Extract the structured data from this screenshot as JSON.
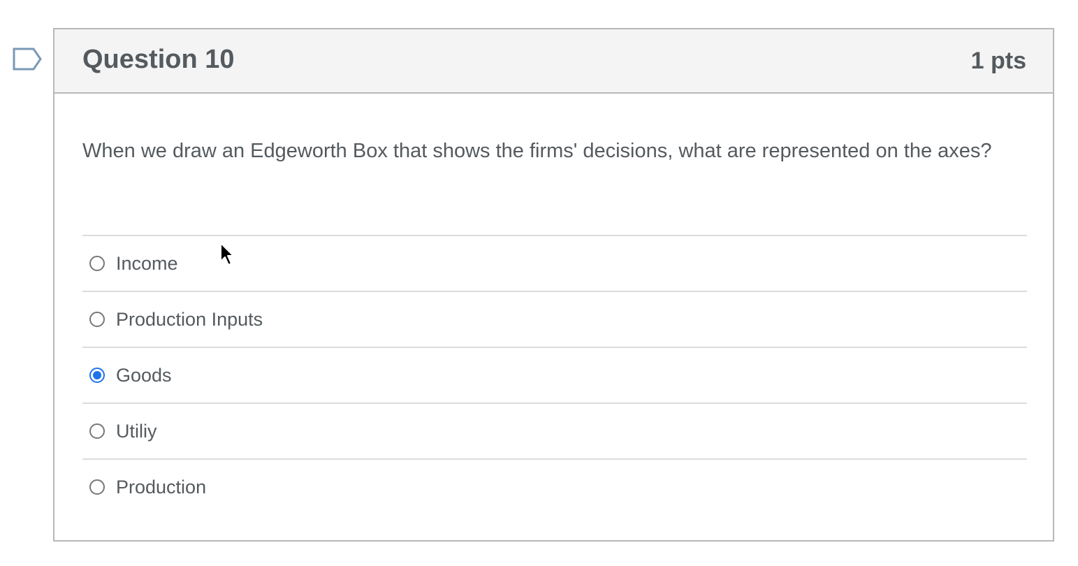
{
  "question": {
    "title": "Question 10",
    "points": "1 pts",
    "text": "When we draw an Edgeworth Box that shows the firms' decisions, what are represented on the axes?"
  },
  "answers": [
    {
      "label": "Income",
      "selected": false
    },
    {
      "label": "Production Inputs",
      "selected": false
    },
    {
      "label": "Goods",
      "selected": true
    },
    {
      "label": "Utiliy",
      "selected": false
    },
    {
      "label": "Production",
      "selected": false
    }
  ],
  "icons": {
    "flag": "flag-icon",
    "cursor": "mouse-pointer-icon"
  },
  "colors": {
    "accent": "#1f73e8",
    "header_bg": "#f4f4f4",
    "border": "#b8b8b8"
  }
}
